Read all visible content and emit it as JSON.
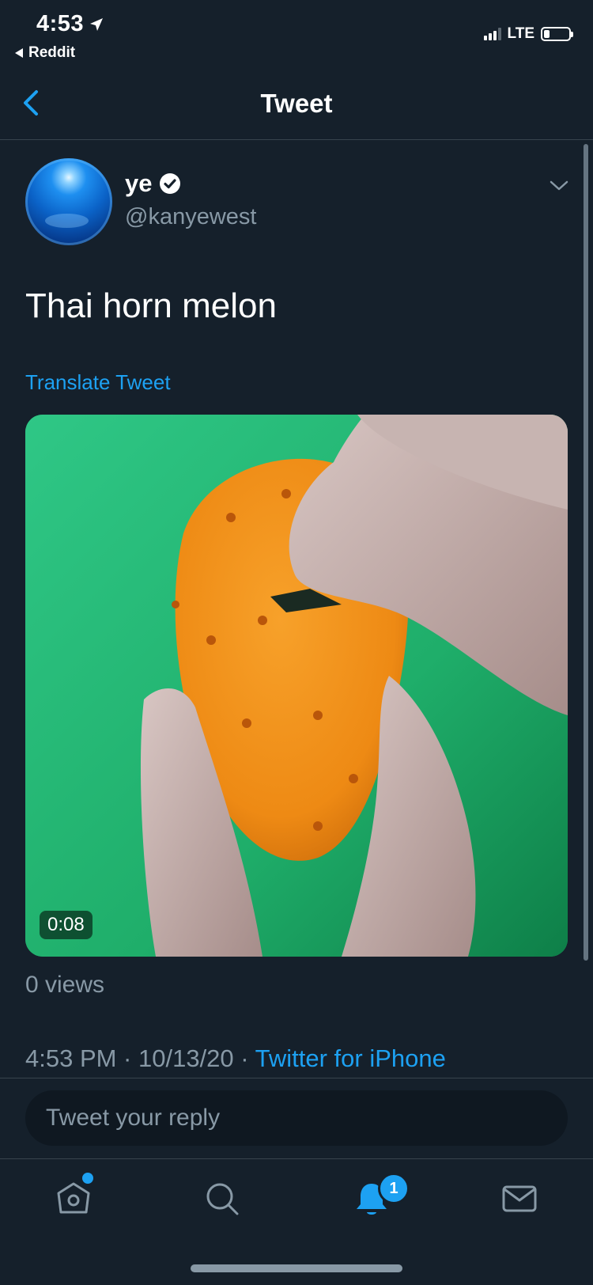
{
  "status_bar": {
    "time": "4:53",
    "back_app": "Reddit",
    "network": "LTE"
  },
  "nav": {
    "title": "Tweet"
  },
  "tweet": {
    "author_name": "ye",
    "author_handle": "@kanyewest",
    "text": "Thai horn melon",
    "translate_label": "Translate Tweet",
    "video_duration": "0:08",
    "views": "0 views",
    "timestamp": "4:53 PM · 10/13/20 · ",
    "source": "Twitter for iPhone"
  },
  "reply": {
    "placeholder": "Tweet your reply"
  },
  "tab_bar": {
    "notifications_badge": "1",
    "icons": [
      "home-icon",
      "search-icon",
      "notifications-icon",
      "messages-icon"
    ]
  },
  "colors": {
    "background": "#15202b",
    "accent": "#1da1f2",
    "secondary_text": "#8899a6",
    "divider": "#38444d"
  }
}
